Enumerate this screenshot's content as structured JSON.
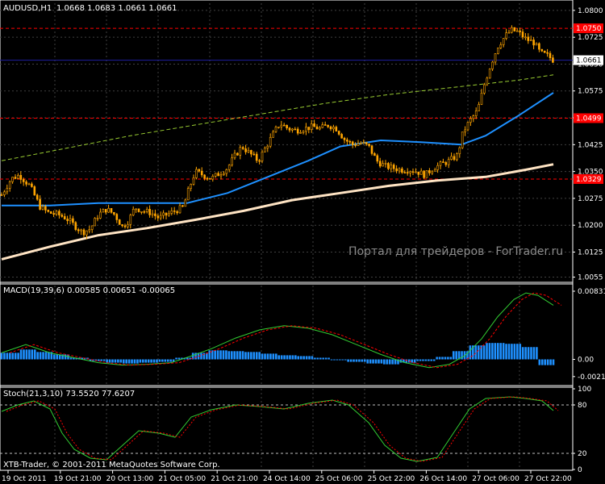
{
  "header": {
    "symbol": "AUDUSD,H1",
    "ohlc": "1.0668 1.0683 1.0661 1.0661",
    "macd_label": "MACD(19,39,6) 0.00585 0.00651 -0.00065",
    "stoch_label": "Stoch(21,3,10) 73.5520 77.6207"
  },
  "footer": {
    "copyright": "XTB-Trader, © 2001-2011 MetaQuotes Software Corp."
  },
  "watermark": "Портал для трейдеров - ForTrader.ru",
  "colors": {
    "background": "#000000",
    "grid": "#404040",
    "border": "#ffffff",
    "candle": "#ffa500",
    "ma_fast": "#1e90ff",
    "ma_slow": "#ffe4c4",
    "ma_long": "#9acd32",
    "level_red": "#ff0000",
    "level_blue": "#1e1ea0",
    "macd_hist": "#1e90ff",
    "macd_signal": "#ff0000",
    "stoch_main": "#32cd32",
    "stoch_signal": "#ff0000"
  },
  "chart_data": [
    {
      "type": "candlestick",
      "title": "AUDUSD,H1",
      "ylim": [
        1.0045,
        1.082
      ],
      "price_ticks": [
        "1.0800",
        "1.0725",
        "1.0650",
        "1.0575",
        "1.0500",
        "1.0425",
        "1.0350",
        "1.0275",
        "1.0200",
        "1.0125",
        "1.0055"
      ],
      "current_price": "1.0661",
      "price_labels": [
        {
          "value": "1.0750",
          "color": "red"
        },
        {
          "value": "1.0499",
          "color": "red"
        },
        {
          "value": "1.0329",
          "color": "red"
        },
        {
          "value": "1.0661",
          "color": "white"
        }
      ],
      "x_labels": [
        "19 Oct 2011",
        "19 Oct 21:00",
        "20 Oct 13:00",
        "21 Oct 05:00",
        "21 Oct 21:00",
        "24 Oct 14:00",
        "25 Oct 06:00",
        "25 Oct 22:00",
        "26 Oct 14:00",
        "27 Oct 06:00",
        "27 Oct 22:00"
      ],
      "close_path": [
        [
          0,
          1.0285
        ],
        [
          12,
          1.033
        ],
        [
          22,
          1.034
        ],
        [
          35,
          1.031
        ],
        [
          48,
          1.025
        ],
        [
          58,
          1.0235
        ],
        [
          70,
          1.023
        ],
        [
          80,
          1.022
        ],
        [
          90,
          1.02
        ],
        [
          100,
          1.018
        ],
        [
          110,
          1.019
        ],
        [
          120,
          1.023
        ],
        [
          130,
          1.0245
        ],
        [
          140,
          1.023
        ],
        [
          150,
          1.0195
        ],
        [
          158,
          1.0215
        ],
        [
          165,
          1.025
        ],
        [
          175,
          1.024
        ],
        [
          185,
          1.0235
        ],
        [
          195,
          1.022
        ],
        [
          205,
          1.023
        ],
        [
          215,
          1.024
        ],
        [
          225,
          1.025
        ],
        [
          232,
          1.03
        ],
        [
          240,
          1.035
        ],
        [
          250,
          1.034
        ],
        [
          260,
          1.033
        ],
        [
          270,
          1.0345
        ],
        [
          280,
          1.036
        ],
        [
          288,
          1.039
        ],
        [
          298,
          1.042
        ],
        [
          308,
          1.04
        ],
        [
          318,
          1.038
        ],
        [
          328,
          1.042
        ],
        [
          338,
          1.046
        ],
        [
          345,
          1.0485
        ],
        [
          355,
          1.047
        ],
        [
          365,
          1.0465
        ],
        [
          375,
          1.047
        ],
        [
          385,
          1.0475
        ],
        [
          395,
          1.047
        ],
        [
          405,
          1.048
        ],
        [
          415,
          1.047
        ],
        [
          425,
          1.044
        ],
        [
          435,
          1.0425
        ],
        [
          445,
          1.043
        ],
        [
          455,
          1.042
        ],
        [
          465,
          1.038
        ],
        [
          475,
          1.0365
        ],
        [
          485,
          1.036
        ],
        [
          495,
          1.0355
        ],
        [
          505,
          1.0355
        ],
        [
          515,
          1.035
        ],
        [
          525,
          1.034
        ],
        [
          535,
          1.036
        ],
        [
          545,
          1.037
        ],
        [
          555,
          1.038
        ],
        [
          565,
          1.0395
        ],
        [
          572,
          1.046
        ],
        [
          580,
          1.049
        ],
        [
          590,
          1.052
        ],
        [
          598,
          1.059
        ],
        [
          605,
          1.064
        ],
        [
          615,
          1.07
        ],
        [
          625,
          1.073
        ],
        [
          632,
          1.0745
        ],
        [
          640,
          1.074
        ],
        [
          650,
          1.072
        ],
        [
          660,
          1.071
        ],
        [
          668,
          1.068
        ],
        [
          676,
          1.0675
        ],
        [
          684,
          1.0661
        ]
      ],
      "ma_fast": [
        [
          0,
          1.0255
        ],
        [
          60,
          1.0255
        ],
        [
          120,
          1.0262
        ],
        [
          180,
          1.0262
        ],
        [
          230,
          1.0262
        ],
        [
          280,
          1.029
        ],
        [
          330,
          1.0335
        ],
        [
          380,
          1.038
        ],
        [
          420,
          1.042
        ],
        [
          470,
          1.0437
        ],
        [
          520,
          1.0432
        ],
        [
          570,
          1.0425
        ],
        [
          600,
          1.045
        ],
        [
          640,
          1.0505
        ],
        [
          684,
          1.057
        ]
      ],
      "ma_slow": [
        [
          0,
          1.0105
        ],
        [
          60,
          1.014
        ],
        [
          120,
          1.0172
        ],
        [
          180,
          1.0192
        ],
        [
          240,
          1.0215
        ],
        [
          300,
          1.024
        ],
        [
          360,
          1.027
        ],
        [
          420,
          1.029
        ],
        [
          480,
          1.031
        ],
        [
          540,
          1.0325
        ],
        [
          600,
          1.0335
        ],
        [
          650,
          1.0355
        ],
        [
          684,
          1.037
        ]
      ],
      "ma_long": [
        [
          0,
          1.038
        ],
        [
          80,
          1.0415
        ],
        [
          160,
          1.045
        ],
        [
          240,
          1.048
        ],
        [
          320,
          1.051
        ],
        [
          400,
          1.054
        ],
        [
          480,
          1.0565
        ],
        [
          560,
          1.0585
        ],
        [
          640,
          1.0605
        ],
        [
          684,
          1.062
        ]
      ]
    },
    {
      "type": "macd",
      "title": "MACD(19,39,6) 0.00585 0.00651 -0.00065",
      "ylim": [
        -0.003,
        0.009
      ],
      "ticks": [
        "0.00831",
        "0.00",
        "-0.0021"
      ],
      "signal_path": [
        [
          0,
          0.0008
        ],
        [
          30,
          0.0018
        ],
        [
          60,
          0.0008
        ],
        [
          90,
          0.0002
        ],
        [
          120,
          -0.0004
        ],
        [
          150,
          -0.0007
        ],
        [
          180,
          -0.0006
        ],
        [
          210,
          -0.0004
        ],
        [
          235,
          0.0004
        ],
        [
          260,
          0.0013
        ],
        [
          290,
          0.0026
        ],
        [
          320,
          0.0036
        ],
        [
          350,
          0.0041
        ],
        [
          380,
          0.0038
        ],
        [
          410,
          0.003
        ],
        [
          440,
          0.0018
        ],
        [
          470,
          0.0006
        ],
        [
          500,
          -0.0004
        ],
        [
          530,
          -0.001
        ],
        [
          555,
          -0.0006
        ],
        [
          575,
          0.0005
        ],
        [
          595,
          0.0025
        ],
        [
          615,
          0.0052
        ],
        [
          635,
          0.0073
        ],
        [
          650,
          0.0081
        ],
        [
          665,
          0.0078
        ],
        [
          684,
          0.0066
        ]
      ],
      "histogram": [
        0.0008,
        0.0012,
        0.0009,
        0.0006,
        0.0002,
        -0.0002,
        -0.0004,
        -0.0005,
        -0.0004,
        -0.0003,
        0.0002,
        0.0008,
        0.0011,
        0.001,
        0.0009,
        0.0007,
        0.0005,
        0.0004,
        0.0002,
        -0.0001,
        -0.0003,
        -0.0005,
        -0.0006,
        -0.0004,
        -0.0002,
        0.0003,
        0.001,
        0.0017,
        0.002,
        0.0019,
        0.0015,
        -0.0007
      ]
    },
    {
      "type": "stochastic",
      "title": "Stoch(21,3,10) 73.5520 77.6207",
      "ylim": [
        0,
        100
      ],
      "ticks": [
        "100",
        "80",
        "20",
        "0"
      ],
      "main_path": [
        [
          0,
          72
        ],
        [
          20,
          80
        ],
        [
          40,
          85
        ],
        [
          60,
          75
        ],
        [
          75,
          45
        ],
        [
          90,
          25
        ],
        [
          110,
          14
        ],
        [
          130,
          12
        ],
        [
          150,
          30
        ],
        [
          170,
          48
        ],
        [
          195,
          45
        ],
        [
          215,
          40
        ],
        [
          235,
          65
        ],
        [
          260,
          74
        ],
        [
          290,
          80
        ],
        [
          320,
          78
        ],
        [
          350,
          75
        ],
        [
          380,
          82
        ],
        [
          410,
          86
        ],
        [
          430,
          80
        ],
        [
          455,
          58
        ],
        [
          475,
          30
        ],
        [
          495,
          14
        ],
        [
          515,
          10
        ],
        [
          540,
          15
        ],
        [
          560,
          45
        ],
        [
          580,
          75
        ],
        [
          600,
          88
        ],
        [
          630,
          90
        ],
        [
          650,
          88
        ],
        [
          670,
          85
        ],
        [
          684,
          73
        ]
      ]
    }
  ]
}
